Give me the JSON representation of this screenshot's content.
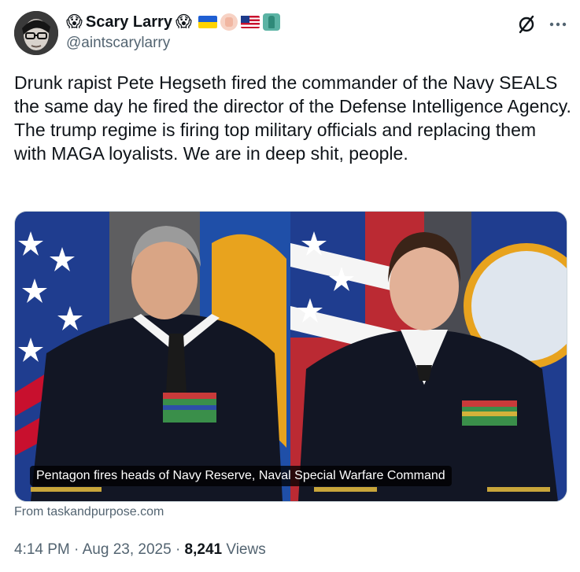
{
  "author": {
    "display_name": "Scary Larry",
    "handle": "@aintscarylarry",
    "name_emoji_left": "😱",
    "name_emoji_right": "😱"
  },
  "tweet": {
    "text": "Drunk rapist Pete Hegseth fired the commander of the Navy SEALS the same day he fired the director of the Defense Intelligence Agency. The trump regime is firing top military officials and replacing them with MAGA loyalists. We are in deep shit, people."
  },
  "media": {
    "caption": "Pentagon fires heads of Navy Reserve, Naval Special Warfare Command",
    "source": "From taskandpurpose.com"
  },
  "meta": {
    "time": "4:14 PM",
    "separator": "·",
    "date": "Aug 23, 2025",
    "views_count": "8,241",
    "views_label": "Views"
  },
  "icons": {
    "grok": "grok-slash-icon",
    "more": "more-horizontal-icon"
  },
  "colors": {
    "text_primary": "#0f1419",
    "text_secondary": "#536471",
    "border": "#cfd9de"
  }
}
